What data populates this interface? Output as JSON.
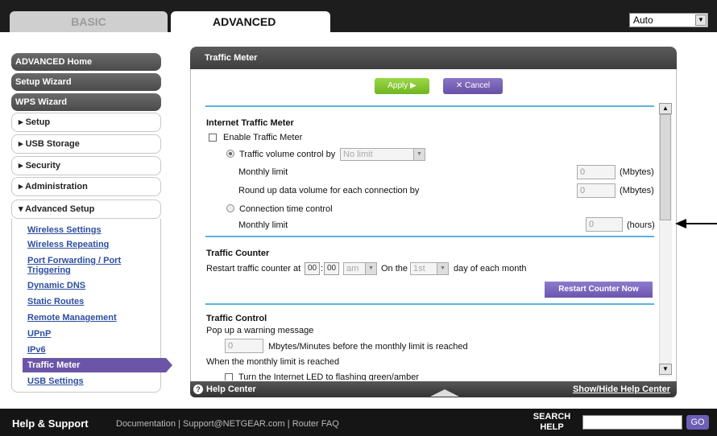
{
  "header": {
    "tabs": [
      {
        "label": "BASIC",
        "active": false
      },
      {
        "label": "ADVANCED",
        "active": true
      }
    ],
    "language_select": "Auto"
  },
  "sidebar": {
    "main_items": [
      "ADVANCED Home",
      "Setup Wizard",
      "WPS Wizard"
    ],
    "sections": [
      "▸ Setup",
      "▸ USB Storage",
      "▸ Security",
      "▸ Administration",
      "▾ Advanced Setup"
    ],
    "sub_items": [
      "Wireless Settings",
      "Wireless Repeating",
      "Port Forwarding / Port Triggering",
      "Dynamic DNS",
      "Static Routes",
      "Remote Management",
      "UPnP",
      "IPv6",
      "Traffic Meter",
      "USB Settings"
    ],
    "active_sub_item": "Traffic Meter"
  },
  "panel": {
    "title": "Traffic Meter",
    "apply_label": "Apply ▶",
    "cancel_label": "✕ Cancel"
  },
  "itm": {
    "heading": "Internet Traffic Meter",
    "enable_label": "Enable Traffic Meter",
    "volume_label": "Traffic volume control by",
    "volume_select": "No limit",
    "monthly_limit_label": "Monthly limit",
    "monthly_limit_value": "0",
    "mbytes_unit": "(Mbytes)",
    "roundup_label": "Round up data volume for each connection by",
    "roundup_value": "0",
    "time_control_label": "Connection time control",
    "time_limit_value": "0",
    "hours_unit": "(hours)"
  },
  "counter": {
    "heading": "Traffic Counter",
    "restart_label": "Restart traffic counter at",
    "hour": "00",
    "minute": "00",
    "ampm": "am",
    "on_the": "On the",
    "day": "1st",
    "day_suffix": "day of each month",
    "restart_button": "Restart Counter Now"
  },
  "control": {
    "heading": "Traffic Control",
    "popup_label": "Pop up a warning message",
    "popup_value": "0",
    "popup_suffix": "Mbytes/Minutes before the monthly limit is reached",
    "when_label": "When the monthly limit is reached",
    "led_label": "Turn the Internet LED to flashing green/amber"
  },
  "help_bar": {
    "help_center": "Help Center",
    "toggle": "Show/Hide Help Center"
  },
  "footer": {
    "title": "Help & Support",
    "link1": "Documentation",
    "link2": "Support@NETGEAR.com",
    "link3": "Router FAQ",
    "search_line1": "SEARCH",
    "search_line2": "HELP",
    "go": "GO"
  }
}
